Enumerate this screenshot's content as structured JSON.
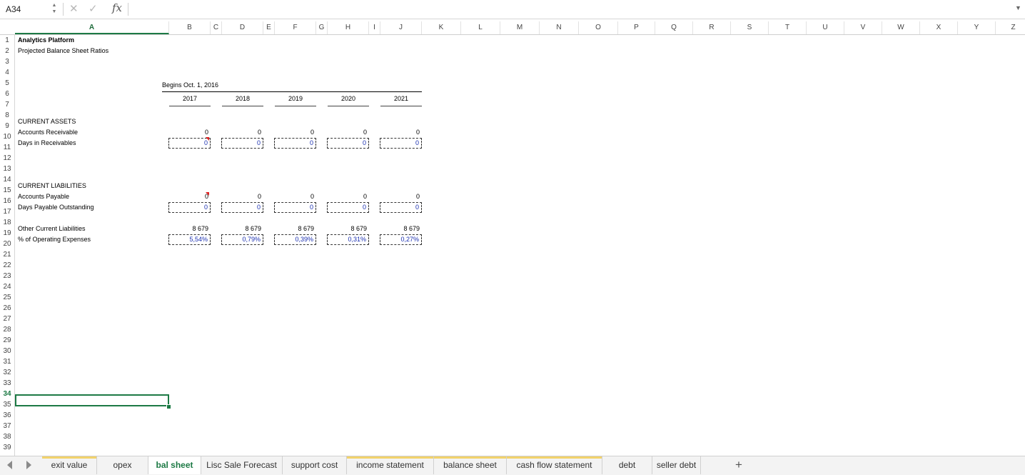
{
  "formula_bar": {
    "name_box": "A34",
    "formula": "",
    "fx_label": "fx"
  },
  "columns": [
    "A",
    "B",
    "C",
    "D",
    "E",
    "F",
    "G",
    "H",
    "I",
    "J",
    "K",
    "L",
    "M",
    "N",
    "O",
    "P",
    "Q",
    "R",
    "S",
    "T",
    "U",
    "V",
    "W",
    "X",
    "Y",
    "Z"
  ],
  "rows": [
    "1",
    "2",
    "3",
    "4",
    "5",
    "6",
    "7",
    "8",
    "9",
    "10",
    "11",
    "12",
    "13",
    "14",
    "15",
    "16",
    "17",
    "18",
    "19",
    "20",
    "21",
    "22",
    "23",
    "24",
    "25",
    "26",
    "27",
    "28",
    "29",
    "30",
    "31",
    "32",
    "33",
    "34",
    "35",
    "36",
    "37",
    "38",
    "39"
  ],
  "sheet": {
    "title": "Analytics Platform",
    "subtitle": "Projected Balance Sheet Ratios",
    "begins": "Begins Oct. 1, 2016",
    "years": [
      "2017",
      "2018",
      "2019",
      "2020",
      "2021"
    ],
    "current_assets": "CURRENT ASSETS",
    "accounts_receivable": "Accounts Receivable",
    "ar_values": [
      "0",
      "0",
      "0",
      "0",
      "0"
    ],
    "days_receivables": "Days in Receivables",
    "dr_values": [
      "0",
      "0",
      "0",
      "0",
      "0"
    ],
    "current_liabilities": "CURRENT LIABILITIES",
    "accounts_payable": "Accounts Payable",
    "ap_values": [
      "0",
      "0",
      "0",
      "0",
      "0"
    ],
    "days_payable": "Days Payable Outstanding",
    "dp_values": [
      "0",
      "0",
      "0",
      "0",
      "0"
    ],
    "other_liabilities": "Other Current Liabilities",
    "ocl_values": [
      "8 679",
      "8 679",
      "8 679",
      "8 679",
      "8 679"
    ],
    "pct_opex": "% of Operating Expenses",
    "pct_values": [
      "5,54%",
      "0,79%",
      "0,39%",
      "0,31%",
      "0,27%"
    ]
  },
  "tabs": [
    {
      "label": "exit value",
      "color": "#f2d26b"
    },
    {
      "label": "opex",
      "color": ""
    },
    {
      "label": "bal sheet",
      "color": ""
    },
    {
      "label": "Lisc Sale Forecast",
      "color": ""
    },
    {
      "label": "support cost",
      "color": ""
    },
    {
      "label": "income statement",
      "color": "#f2d26b"
    },
    {
      "label": "balance sheet",
      "color": "#f2d26b"
    },
    {
      "label": "cash flow statement",
      "color": "#f2d26b"
    },
    {
      "label": "debt",
      "color": ""
    },
    {
      "label": "seller debt",
      "color": ""
    }
  ],
  "active_tab": "bal sheet",
  "active_cell": {
    "col": "A",
    "row": "34"
  },
  "accent_color": "#1d7a45"
}
